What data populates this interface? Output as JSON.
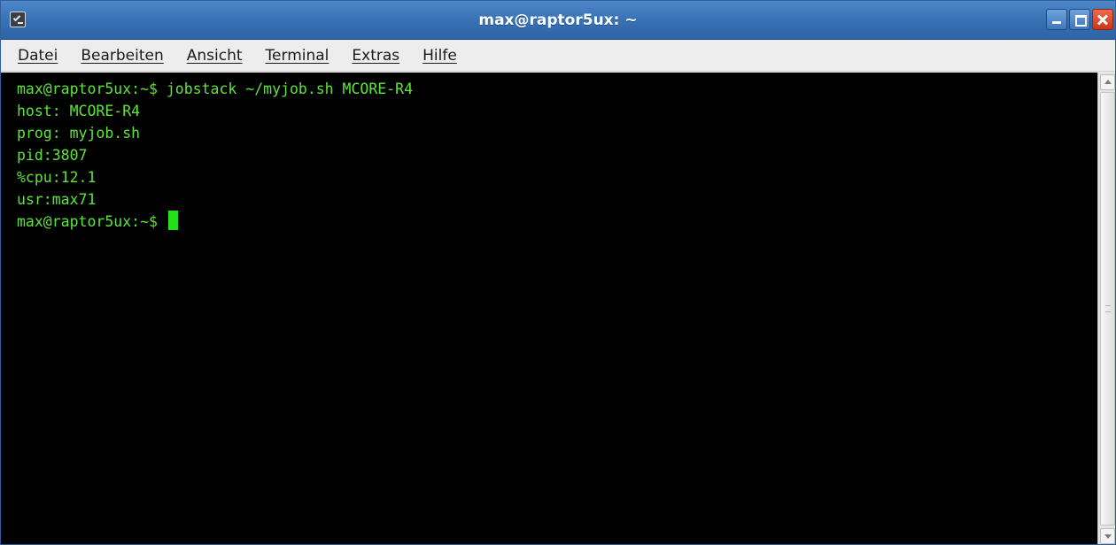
{
  "window": {
    "title": "max@raptor5ux: ~",
    "icon": "terminal-icon",
    "buttons": [
      "minimize-icon",
      "maximize-icon",
      "close-icon"
    ]
  },
  "menubar": {
    "items": [
      {
        "label": "Datei"
      },
      {
        "label": "Bearbeiten"
      },
      {
        "label": "Ansicht"
      },
      {
        "label": "Terminal"
      },
      {
        "label": "Extras"
      },
      {
        "label": "Hilfe"
      }
    ]
  },
  "terminal": {
    "lines": [
      "max@raptor5ux:~$ jobstack ~/myjob.sh MCORE-R4",
      "host: MCORE-R4",
      "prog: myjob.sh",
      "pid:3807",
      "%cpu:12.1",
      "usr:max71"
    ],
    "prompt": "max@raptor5ux:~$ "
  },
  "colors": {
    "titlebar": "#3a73b7",
    "terminal_bg": "#000000",
    "terminal_fg": "#5fe33a",
    "cursor": "#22e01a",
    "close_button": "#c9361a"
  }
}
